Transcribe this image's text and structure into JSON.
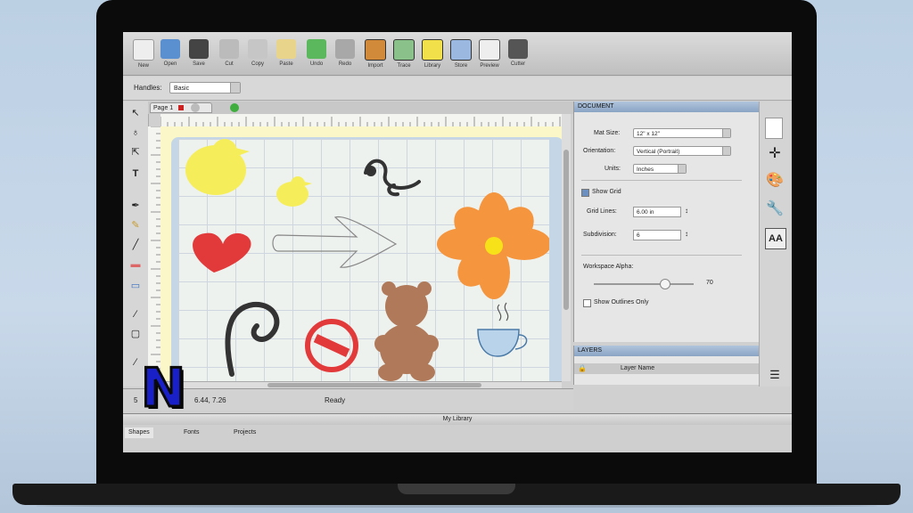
{
  "toolbar": {
    "items": [
      {
        "label": "New",
        "icon": "new-document-icon"
      },
      {
        "label": "Open",
        "icon": "open-folder-icon"
      },
      {
        "label": "Save",
        "icon": "save-icon"
      },
      {
        "label": "Cut",
        "icon": "cut-icon"
      },
      {
        "label": "Copy",
        "icon": "copy-icon"
      },
      {
        "label": "Paste",
        "icon": "paste-icon"
      },
      {
        "label": "Undo",
        "icon": "undo-icon"
      },
      {
        "label": "Redo",
        "icon": "redo-icon"
      },
      {
        "label": "Import",
        "icon": "import-icon"
      },
      {
        "label": "Trace",
        "icon": "trace-icon"
      },
      {
        "label": "Library",
        "icon": "library-icon"
      },
      {
        "label": "Store",
        "icon": "store-icon"
      },
      {
        "label": "Preview",
        "icon": "preview-icon"
      },
      {
        "label": "Cutter",
        "icon": "cutter-icon"
      }
    ]
  },
  "handles": {
    "label": "Handles:",
    "value": "Basic"
  },
  "page_tab": {
    "label": "Page 1"
  },
  "status": {
    "coords": "6.44, 7.26",
    "state": "Ready",
    "zoom": "5"
  },
  "document_panel": {
    "title": "DOCUMENT",
    "mat_size_label": "Mat Size:",
    "mat_size_value": "12\" x 12\"",
    "orientation_label": "Orientation:",
    "orientation_value": "Vertical (Portrait)",
    "units_label": "Units:",
    "units_value": "Inches",
    "show_grid_label": "Show Grid",
    "grid_lines_label": "Grid Lines:",
    "grid_lines_value": "6.00 in",
    "subdivision_label": "Subdivision:",
    "subdivision_value": "6",
    "workspace_alpha_label": "Workspace Alpha:",
    "workspace_alpha_value": "70",
    "show_outlines_label": "Show Outlines Only"
  },
  "layers_panel": {
    "title": "LAYERS",
    "column": "Layer Name"
  },
  "library": {
    "title": "My Library",
    "tabs": [
      "Shapes",
      "Fonts",
      "Projects"
    ]
  },
  "logo": {
    "letter": "N"
  },
  "colors": {
    "accent": "#8aa4c4",
    "duck": "#f5ee5a",
    "heart": "#e23a3a",
    "flower": "#f5953e",
    "flower_center": "#f7e21a",
    "bear": "#b07a5a",
    "no_sign": "#e23a3a",
    "swirl": "#333333",
    "cup": "#8ab4d8"
  }
}
